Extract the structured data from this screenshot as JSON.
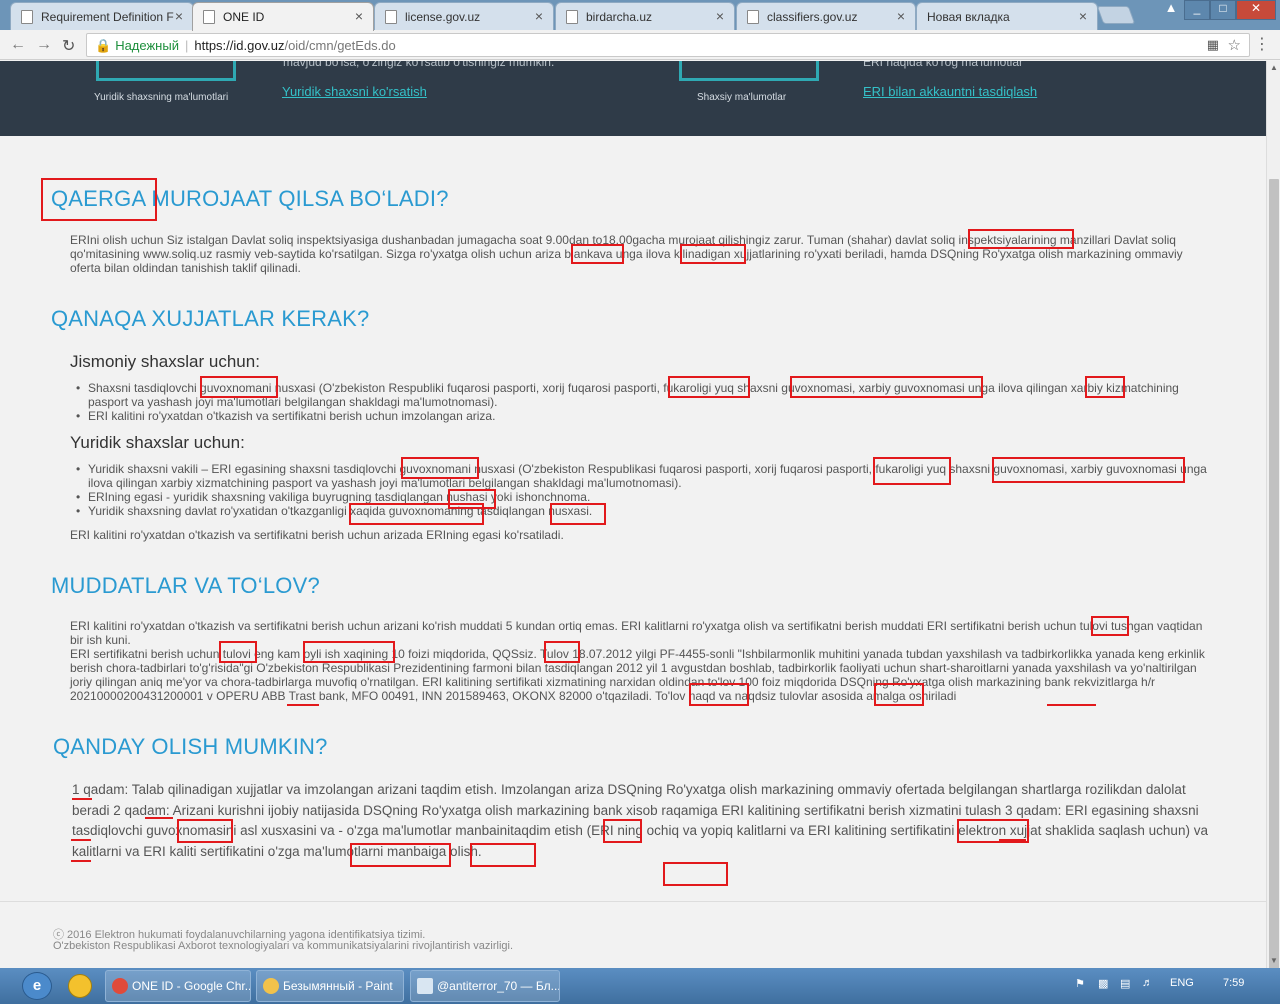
{
  "browser": {
    "tabs": [
      {
        "label": "Requirement Definition F",
        "active": false
      },
      {
        "label": "ONE ID",
        "active": true
      },
      {
        "label": "license.gov.uz",
        "active": false
      },
      {
        "label": "birdarcha.uz",
        "active": false
      },
      {
        "label": "classifiers.gov.uz",
        "active": false
      },
      {
        "label": "Новая вкладка",
        "active": false
      }
    ],
    "secure_label": "Надежный",
    "url_host": "https://id.gov.uz",
    "url_path": "/oid/cmn/getEds.do",
    "window_controls": [
      "_",
      "□",
      "✕"
    ]
  },
  "band": {
    "left_caption": "Yuridik shaxsning ma'lumotlari",
    "left_text": "mavjud bo'lsa, o'zingiz ko'rsatib o'tishingiz mumkin.",
    "left_link": "Yuridik shaxsni ko'rsatish",
    "right_caption": "Shaxsiy ma'lumotlar",
    "right_text": "ERI haqida ko'rog ma'lumotlar",
    "right_link": "ERI bilan akkauntni tasdiqlash"
  },
  "sections": {
    "where": {
      "title": "QAERGA MUROJAAT QILSA BO‘LADI?",
      "text": "ERIni olish uchun Siz istalgan Davlat soliq inspektsiyasiga dushanbadan jumagacha soat 9.00dan to18.00gacha murojaat qilishingiz zarur. Tuman (shahar) davlat soliq inspektsiyalarining manzillari Davlat soliq qo'mitasining www.soliq.uz rasmiy veb-saytida ko'rsatilgan. Sizga ro'yxatga olish uchun ariza blankava unga ilova kilinadigan xujjatlarining ro'yxati beriladi, hamda DSQning Ro'yxatga olish markazining ommaviy oferta bilan oldindan tanishish taklif qilinadi."
    },
    "docs": {
      "title": "QANAQA XUJJATLAR KERAK?",
      "physical_title": "Jismoniy shaxslar uchun:",
      "physical_items": [
        "Shaxsni tasdiqlovchi guvoxnomani nusxasi (O'zbekiston Respubliki fuqarosi pasporti, xorij fuqarosi pasporti, fukaroligi yuq shaxsni guvoxnomasi, xarbiy guvoxnomasi unga ilova qilingan xarbiy kizmatchining pasport va yashash joyi ma'lumotlari belgilangan shakldagi ma'lumotnomasi).",
        "ERI kalitini ro'yxatdan o'tkazish va sertifikatni berish uchun imzolangan ariza."
      ],
      "legal_title": "Yuridik shaxslar uchun:",
      "legal_items": [
        "Yuridik shaxsni vakili – ERI egasining shaxsni tasdiqlovchi guvoxnomani nusxasi (O'zbekiston Respublikasi fuqarosi pasporti, xorij fuqarosi pasporti, fukaroligi yuq shaxsni guvoxnomasi, xarbiy guvoxnomasi unga ilova qilingan xarbiy xizmatchining pasport va yashash joyi ma'lumotlari belgilangan shakldagi ma'lumotnomasi).",
        "ERIning egasi - yuridik shaxsning vakiliga buyrugning tasdiqlangan nushasi yoki ishonchnoma.",
        "Yuridik shaxsning davlat ro'yxatidan o'tkazganligi xaqida guvoxnomaning tasdiqlangan nusxasi."
      ],
      "note": "ERI kalitini ro'yxatdan o'tkazish va sertifikatni berish uchun arizada ERIning egasi ko'rsatiladi."
    },
    "terms": {
      "title": "MUDDATLAR VA TO‘LOV?",
      "p1": "ERI kalitini ro'yxatdan o'tkazish va sertifikatni berish uchun arizani ko'rish muddati 5 kundan ortiq emas. ERI kalitlarni ro'yxatga olish va sertifikatni berish muddati ERI sertifikatni berish uchun tulovi tushgan vaqtidan bir ish kuni.",
      "p2": "ERI sertifikatni berish uchun tulovi eng kam oyli ish xaqining 10 foizi miqdorida, QQSsiz. Tulov 18.07.2012 yilgi PF-4455-sonli \"Ishbilarmonlik muhitini yanada tubdan yaxshilash va tadbirkorlikka yanada keng erkinlik berish chora-tadbirlari to'g'risida\"gi O'zbekiston Respublikasi Prezidentining farmoni bilan tasdiqlangan 2012 yil 1 avgustdan boshlab, tadbirkorlik faoliyati uchun shart-sharoitlarni yanada yaxshilash va yo'naltirilgan joriy qilingan aniq me'yor va chora-tadbirlarga muvofiq o'rnatilgan. ERI kalitining sertifikati xizmatining narxidan oldindan to'lov 100 foiz miqdorida DSQning Ro'yxatga olish markazining bank rekvizitlarga h/r 20210000200431200001 v OPERU ABB Trast bank, MFO 00491, INN 201589463, OKONX 82000 o'tqaziladi. To'lov naqd va naqdsiz tulovlar asosida amalga oshiriladi"
    },
    "how": {
      "title": "QANDAY OLISH MUMKIN?",
      "text": "1 qadam: Talab qilinadigan xujjatlar va imzolangan arizani taqdim etish. Imzolangan ariza DSQning Ro'yxatga olish markazining ommaviy ofertada belgilangan shartlarga rozilikdan dalolat beradi 2 qadam: Arizani kurishni ijobiy natijasida DSQning Ro'yxatga olish markazining bank xisob raqamiga ERI kalitining sertifikatni berish xizmatini tulash 3 qadam: ERI egasining shaxsni tasdiqlovchi guvoxnomasini asl xusxasini va - o'zga ma'lumotlar manbainitaqdim etish (ERI ning ochiq va yopiq kalitlarni va ERI kalitining sertifikatini elektron xujjat shaklida saqlash uchun) va kalitlarni va ERI kaliti sertifikatini o'zga ma'lumotlarni manbaiga olish."
    }
  },
  "footer": {
    "line1": "ⓒ 2016 Elektron hukumati foydalanuvchilarning yagona identifikatsiya tizimi.",
    "line2": "O'zbekiston Respublikasi Axborot texnologiyalari va kommunikatsiyalarini rivojlantirish vazirligi."
  },
  "taskbar": {
    "items": [
      "ONE ID - Google Chr...",
      "Безымянный - Paint",
      "@antiterror_70 — Бл..."
    ],
    "lang": "ENG",
    "time": "7:59"
  },
  "colors": {
    "heading": "#2a9ad1",
    "annotation": "#e2191c",
    "band": "#2f3b48",
    "link": "#34c1c8"
  }
}
